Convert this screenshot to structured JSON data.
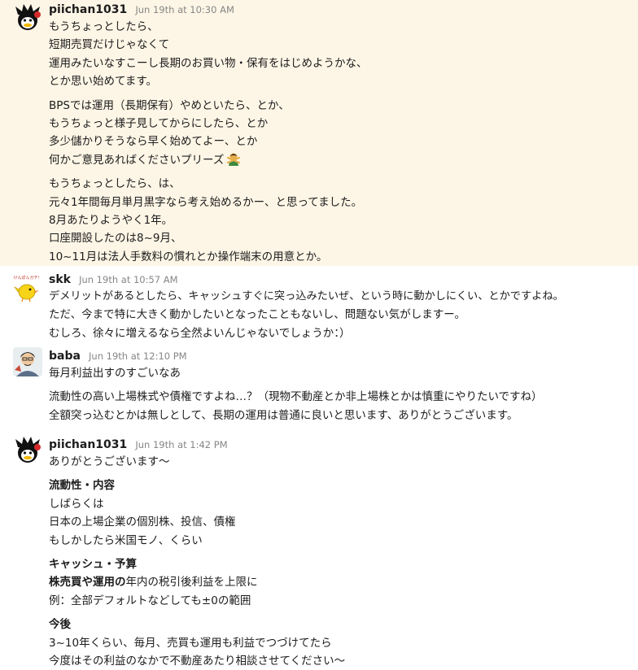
{
  "messages": [
    {
      "user": "piichan1031",
      "time": "Jun 19th at 10:30 AM",
      "paragraphs": [
        [
          "もうちょっとしたら、",
          "短期売買だけじゃなくて",
          "運用みたいなすこーし長期のお買い物・保有をはじめようかな、",
          "とか思い始めてます。"
        ],
        [
          "BPSでは運用（長期保有）やめといたら、とか、",
          "もうちょっと様子見してからにしたら、とか",
          "多少儲かりそうなら早く始めてよー、とか",
          "何かご意見あればくださいプリーズ"
        ],
        [
          "もうちょっとしたら、は、",
          "元々1年間毎月単月黒字なら考え始めるかー、と思ってました。",
          "8月あたりようやく1年。",
          "口座開設したのは8~9月、",
          "10~11月は法人手数料の慣れとか操作端末の用意とか。"
        ]
      ],
      "emoji": "person-gesturing-no-emoji"
    },
    {
      "user": "skk",
      "time": "Jun 19th at 10:57 AM",
      "avatar_text": "けんぽんガチ！",
      "paragraphs": [
        [
          "デメリットがあるとしたら、キャッシュすぐに突っ込みたいぜ、という時に動かしにくい、とかですよね。",
          "ただ、今まで特に大きく動かしたいとなったこともないし、問題ない気がしますー。",
          "むしろ、徐々に増えるなら全然よいんじゃないでしょうか：）"
        ]
      ]
    },
    {
      "user": "baba",
      "time": "Jun 19th at 12:10 PM",
      "paragraphs": [
        [
          "毎月利益出すのすごいなあ"
        ],
        [
          "流動性の高い上場株式や債権ですよね…？（現物不動産とか非上場株とかは慎重にやりたいですね）",
          "全額突っ込むとかは無しとして、長期の運用は普通に良いと思います、ありがとうございます。"
        ]
      ]
    },
    {
      "user": "piichan1031",
      "time": "Jun 19th at 1:42 PM",
      "intro": "ありがとうございます〜",
      "sections": [
        {
          "heading": "流動性・内容",
          "lines": [
            "しばらくは",
            "日本の上場企業の個別株、投信、債権",
            "もしかしたら米国モノ、くらい"
          ]
        },
        {
          "heading": "キャッシュ・予算",
          "bold_prefix": "株売買や運用の",
          "line_rest": "年内の税引後利益を上限に",
          "lines": [
            "例：全部デフォルトなどしても±0の範囲"
          ]
        },
        {
          "heading": "今後",
          "lines": [
            "3~10年くらい、毎月、売買も運用も利益でつづけてたら",
            "今度はその利益のなかで不動産あたり相談させてください〜"
          ]
        }
      ]
    }
  ]
}
